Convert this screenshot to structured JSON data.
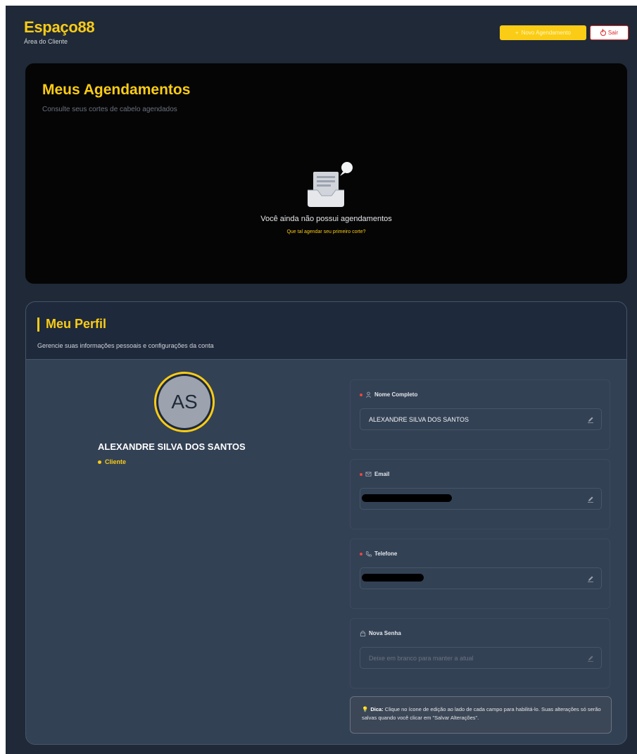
{
  "header": {
    "brand": "Espaço88",
    "subtitle": "Área do Cliente",
    "new_button": "Novo Agendamento",
    "exit_button": "Sair"
  },
  "appointments": {
    "title": "Meus Agendamentos",
    "subtitle": "Consulte seus cortes de cabelo agendados",
    "empty_title": "Você ainda não possui agendamentos",
    "empty_link": "Que tal agendar seu primeiro corte?"
  },
  "profile": {
    "title": "Meu Perfil",
    "subtitle": "Gerencie suas informações pessoais e configurações da conta",
    "initials": "AS",
    "name": "ALEXANDRE SILVA DOS SANTOS",
    "role": "Cliente",
    "fields": {
      "name": {
        "label": "Nome Completo",
        "value": "ALEXANDRE SILVA DOS SANTOS"
      },
      "email": {
        "label": "Email",
        "value": ""
      },
      "phone": {
        "label": "Telefone",
        "value": ""
      },
      "password": {
        "label": "Nova Senha",
        "placeholder": "Deixe em branco para manter a atual"
      }
    },
    "tip_label": "Dica:",
    "tip_text": "Clique no ícone de edição ao lado de cada campo para habilitá-lo. Suas alterações só serão salvas quando você clicar em \"Salvar Alterações\"."
  }
}
